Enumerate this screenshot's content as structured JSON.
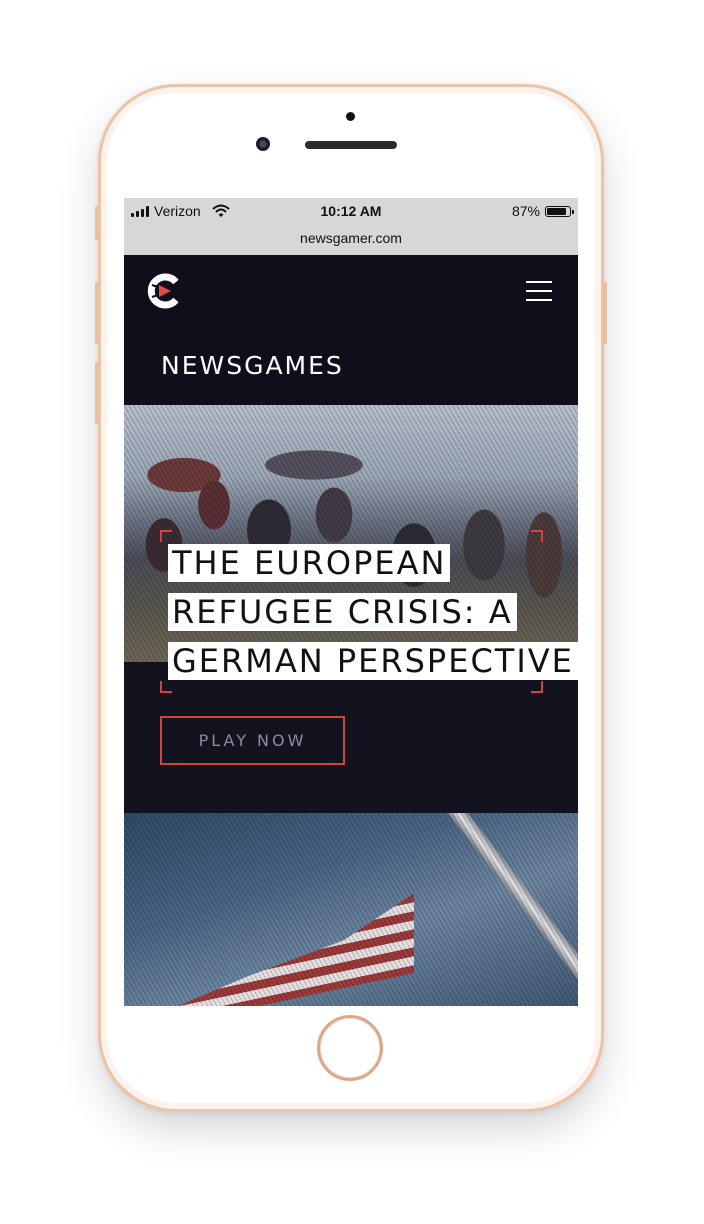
{
  "status_bar": {
    "carrier": "Verizon",
    "time": "10:12 AM",
    "battery_percent": "87%",
    "battery_level": 0.87,
    "url": "newsgamer.com"
  },
  "header": {
    "logo_icon": "newsgamer-logo-icon",
    "menu_icon": "hamburger-menu-icon",
    "section_title": "NEWSGAMES"
  },
  "feature": {
    "headline_lines": [
      "THE EUROPEAN",
      "REFUGEE CRISIS: A",
      "GERMAN PERSPECTIVE"
    ],
    "cta_label": "PLAY NOW"
  },
  "colors": {
    "accent": "#d0443c",
    "background_dark": "#13121f",
    "status_bar_bg": "#d7d7d7"
  }
}
